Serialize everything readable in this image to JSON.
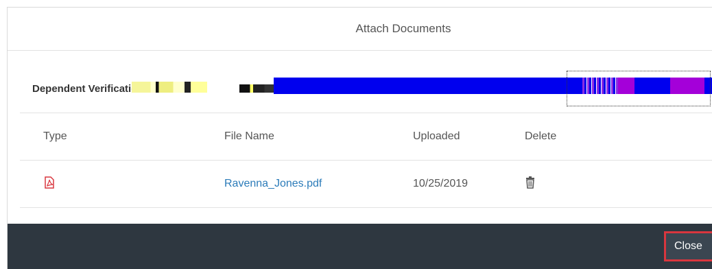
{
  "dialog": {
    "title": "Attach Documents"
  },
  "section": {
    "title": "Dependent Verification Doc"
  },
  "table": {
    "headers": {
      "type": "Type",
      "file_name": "File Name",
      "uploaded": "Uploaded",
      "delete": "Delete"
    },
    "rows": [
      {
        "type_icon": "pdf-icon",
        "file_name": "Ravenna_Jones.pdf",
        "uploaded": "10/25/2019",
        "delete_icon": "trash-icon"
      }
    ]
  },
  "footer": {
    "close_label": "Close"
  },
  "colors": {
    "footer_bg": "#2e3740",
    "link": "#2b7bb9",
    "pdf_icon": "#d9363e",
    "close_highlight": "#d9363e"
  }
}
